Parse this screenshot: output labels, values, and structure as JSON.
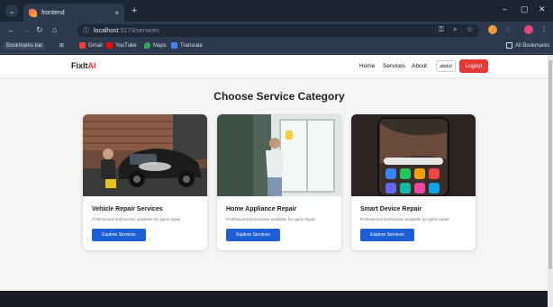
{
  "browser": {
    "tab_title": "frontend",
    "tab_close": "×",
    "new_tab": "+",
    "window_controls": {
      "minimize": "–",
      "maximize": "▢",
      "close": "✕"
    },
    "url_host": "localhost",
    "url_path": ":5173/services",
    "bookmarks": [
      {
        "label": "Bookmarks bar",
        "color": "#3b4a60"
      },
      {
        "label": "Gmail",
        "color": "#ea4335"
      },
      {
        "label": "YouTube",
        "color": "#ff0000"
      },
      {
        "label": "Maps",
        "color": "#34a853"
      },
      {
        "label": "Translate",
        "color": "#4285f4"
      }
    ],
    "all_bookmarks": "All Bookmarks"
  },
  "site": {
    "logo_main": "FixIt",
    "logo_accent": "AI",
    "accent_color": "#e53935",
    "nav": {
      "home": "Home",
      "services": "Services",
      "about": "About"
    },
    "user": "abdul",
    "logout": "Logout"
  },
  "main": {
    "heading": "Choose Service Category",
    "cards": [
      {
        "title": "Vehicle Repair Services",
        "description": "Professional technicians available for quick repair.",
        "button": "Explore Services"
      },
      {
        "title": "Home Appliance Repair",
        "description": "Professional technicians available for quick repair.",
        "button": "Explore Services"
      },
      {
        "title": "Smart Device Repair",
        "description": "Professional technicians available for quick repair.",
        "button": "Explore Services"
      }
    ],
    "button_color": "#1e5fd8"
  }
}
